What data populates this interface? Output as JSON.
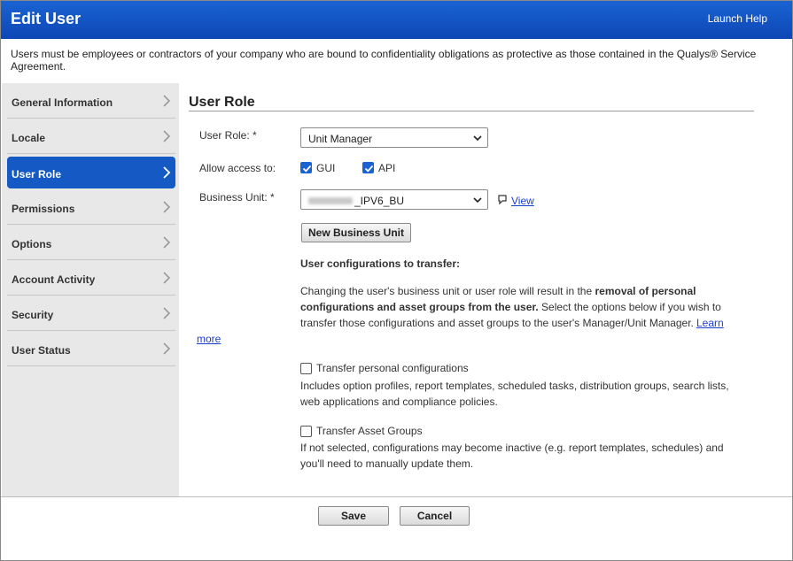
{
  "header": {
    "title": "Edit User",
    "launch_help": "Launch Help",
    "accent_color": "#1559c4"
  },
  "notice": "Users must be employees or contractors of your company who are bound to confidentiality obligations as protective as those contained in the Qualys® Service Agreement.",
  "sidebar": {
    "items": [
      {
        "label": "General Information",
        "active": false
      },
      {
        "label": "Locale",
        "active": false
      },
      {
        "label": "User Role",
        "active": true
      },
      {
        "label": "Permissions",
        "active": false
      },
      {
        "label": "Options",
        "active": false
      },
      {
        "label": "Account Activity",
        "active": false
      },
      {
        "label": "Security",
        "active": false
      },
      {
        "label": "User Status",
        "active": false
      }
    ]
  },
  "main": {
    "section_title": "User Role",
    "user_role": {
      "label": "User Role: *",
      "value": "Unit Manager"
    },
    "allow_access": {
      "label": "Allow access to:",
      "options": [
        {
          "label": "GUI",
          "checked": true
        },
        {
          "label": "API",
          "checked": true
        }
      ]
    },
    "business_unit": {
      "label": "Business Unit: *",
      "value": "_IPV6_BU",
      "view_link": "View"
    },
    "new_business_unit_button": "New Business Unit",
    "transfer_heading": "User configurations to transfer:",
    "transfer_desc": {
      "part1": "Changing the user's business unit or user role will result in the ",
      "bold": "removal of personal configurations and asset groups from the user.",
      "part2": " Select the options below if you wish to transfer those configurations and asset groups to the user's Manager/Unit Manager. ",
      "link": "Learn more"
    },
    "transfer_personal": {
      "label": "Transfer personal configurations",
      "checked": false,
      "description": "Includes option profiles, report templates, scheduled tasks, distribution groups, search lists, web applications and compliance policies."
    },
    "transfer_asset_groups": {
      "label": "Transfer Asset Groups",
      "checked": false,
      "description": "If not selected, configurations may become inactive (e.g. report templates, schedules) and you'll need to manually update them."
    }
  },
  "footer": {
    "save": "Save",
    "cancel": "Cancel"
  }
}
